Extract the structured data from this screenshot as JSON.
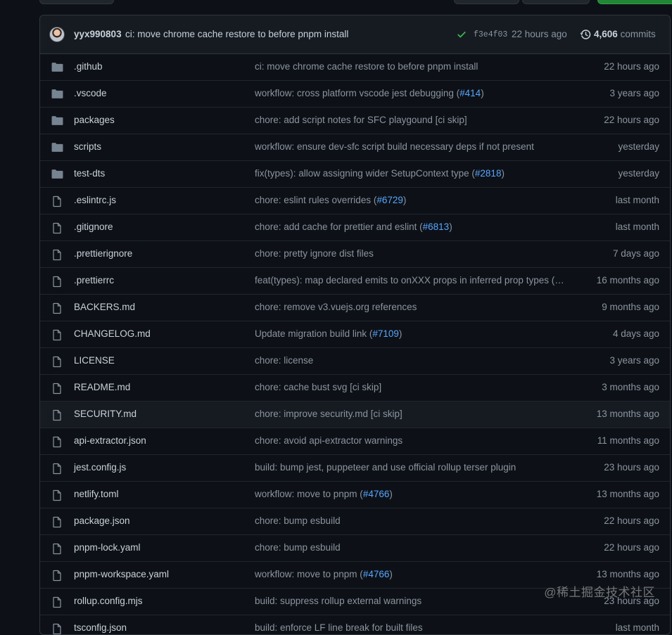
{
  "colors": {
    "background": "#0d1117",
    "header_bg": "#161b22",
    "border": "#30363d",
    "text": "#c9d1d9",
    "muted": "#8b949e",
    "link": "#58a6ff",
    "success": "#3fb950",
    "folder": "#768390"
  },
  "latest_commit": {
    "author": "yyx990803",
    "message": "ci: move chrome cache restore to before pnpm install",
    "status_icon": "check-icon",
    "sha": "f3e4f03",
    "time": "22 hours ago",
    "commits_count": "4,606",
    "commits_label": "commits"
  },
  "files": [
    {
      "type": "dir",
      "icon": "folder-icon",
      "name": ".github",
      "msg_text": "ci: move chrome cache restore to before pnpm install",
      "msg_link": "",
      "msg_suffix": "",
      "time": "22 hours ago"
    },
    {
      "type": "dir",
      "icon": "folder-icon",
      "name": ".vscode",
      "msg_text": "workflow: cross platform vscode jest debugging (",
      "msg_link": "#414",
      "msg_suffix": ")",
      "time": "3 years ago"
    },
    {
      "type": "dir",
      "icon": "folder-icon",
      "name": "packages",
      "msg_text": "chore: add script notes for SFC playgound [ci skip]",
      "msg_link": "",
      "msg_suffix": "",
      "time": "22 hours ago"
    },
    {
      "type": "dir",
      "icon": "folder-icon",
      "name": "scripts",
      "msg_text": "workflow: ensure dev-sfc script build necessary deps if not present",
      "msg_link": "",
      "msg_suffix": "",
      "time": "yesterday"
    },
    {
      "type": "dir",
      "icon": "folder-icon",
      "name": "test-dts",
      "msg_text": "fix(types): allow assigning wider SetupContext type (",
      "msg_link": "#2818",
      "msg_suffix": ")",
      "time": "yesterday"
    },
    {
      "type": "file",
      "icon": "file-icon",
      "name": ".eslintrc.js",
      "msg_text": "chore: eslint rules overrides (",
      "msg_link": "#6729",
      "msg_suffix": ")",
      "time": "last month"
    },
    {
      "type": "file",
      "icon": "file-icon",
      "name": ".gitignore",
      "msg_text": "chore: add cache for prettier and eslint (",
      "msg_link": "#6813",
      "msg_suffix": ")",
      "time": "last month"
    },
    {
      "type": "file",
      "icon": "file-icon",
      "name": ".prettierignore",
      "msg_text": "chore: pretty ignore dist files",
      "msg_link": "",
      "msg_suffix": "",
      "time": "7 days ago"
    },
    {
      "type": "file",
      "icon": "file-icon",
      "name": ".prettierrc",
      "msg_text": "feat(types): map declared emits to onXXX props in inferred prop types (…",
      "msg_link": "",
      "msg_suffix": "",
      "time": "16 months ago"
    },
    {
      "type": "file",
      "icon": "file-icon",
      "name": "BACKERS.md",
      "msg_text": "chore: remove v3.vuejs.org references",
      "msg_link": "",
      "msg_suffix": "",
      "time": "9 months ago"
    },
    {
      "type": "file",
      "icon": "file-icon",
      "name": "CHANGELOG.md",
      "msg_text": "Update migration build link (",
      "msg_link": "#7109",
      "msg_suffix": ")",
      "time": "4 days ago"
    },
    {
      "type": "file",
      "icon": "file-icon",
      "name": "LICENSE",
      "msg_text": "chore: license",
      "msg_link": "",
      "msg_suffix": "",
      "time": "3 years ago"
    },
    {
      "type": "file",
      "icon": "file-icon",
      "name": "README.md",
      "msg_text": "chore: cache bust svg [ci skip]",
      "msg_link": "",
      "msg_suffix": "",
      "time": "3 months ago"
    },
    {
      "type": "file",
      "icon": "file-icon",
      "name": "SECURITY.md",
      "msg_text": "chore: improve security.md [ci skip]",
      "msg_link": "",
      "msg_suffix": "",
      "time": "13 months ago",
      "hover": true
    },
    {
      "type": "file",
      "icon": "file-icon",
      "name": "api-extractor.json",
      "msg_text": "chore: avoid api-extractor warnings",
      "msg_link": "",
      "msg_suffix": "",
      "time": "11 months ago"
    },
    {
      "type": "file",
      "icon": "file-icon",
      "name": "jest.config.js",
      "msg_text": "build: bump jest, puppeteer and use official rollup terser plugin",
      "msg_link": "",
      "msg_suffix": "",
      "time": "23 hours ago"
    },
    {
      "type": "file",
      "icon": "file-icon",
      "name": "netlify.toml",
      "msg_text": "workflow: move to pnpm (",
      "msg_link": "#4766",
      "msg_suffix": ")",
      "time": "13 months ago"
    },
    {
      "type": "file",
      "icon": "file-icon",
      "name": "package.json",
      "msg_text": "chore: bump esbuild",
      "msg_link": "",
      "msg_suffix": "",
      "time": "22 hours ago"
    },
    {
      "type": "file",
      "icon": "file-icon",
      "name": "pnpm-lock.yaml",
      "msg_text": "chore: bump esbuild",
      "msg_link": "",
      "msg_suffix": "",
      "time": "22 hours ago"
    },
    {
      "type": "file",
      "icon": "file-icon",
      "name": "pnpm-workspace.yaml",
      "msg_text": "workflow: move to pnpm (",
      "msg_link": "#4766",
      "msg_suffix": ")",
      "time": "13 months ago"
    },
    {
      "type": "file",
      "icon": "file-icon",
      "name": "rollup.config.mjs",
      "msg_text": "build: suppress rollup external warnings",
      "msg_link": "",
      "msg_suffix": "",
      "time": "23 hours ago"
    },
    {
      "type": "file",
      "icon": "file-icon",
      "name": "tsconfig.json",
      "msg_text": "build: enforce LF line break for built files",
      "msg_link": "",
      "msg_suffix": "",
      "time": "last month"
    }
  ],
  "watermark": "@稀土掘金技术社区"
}
